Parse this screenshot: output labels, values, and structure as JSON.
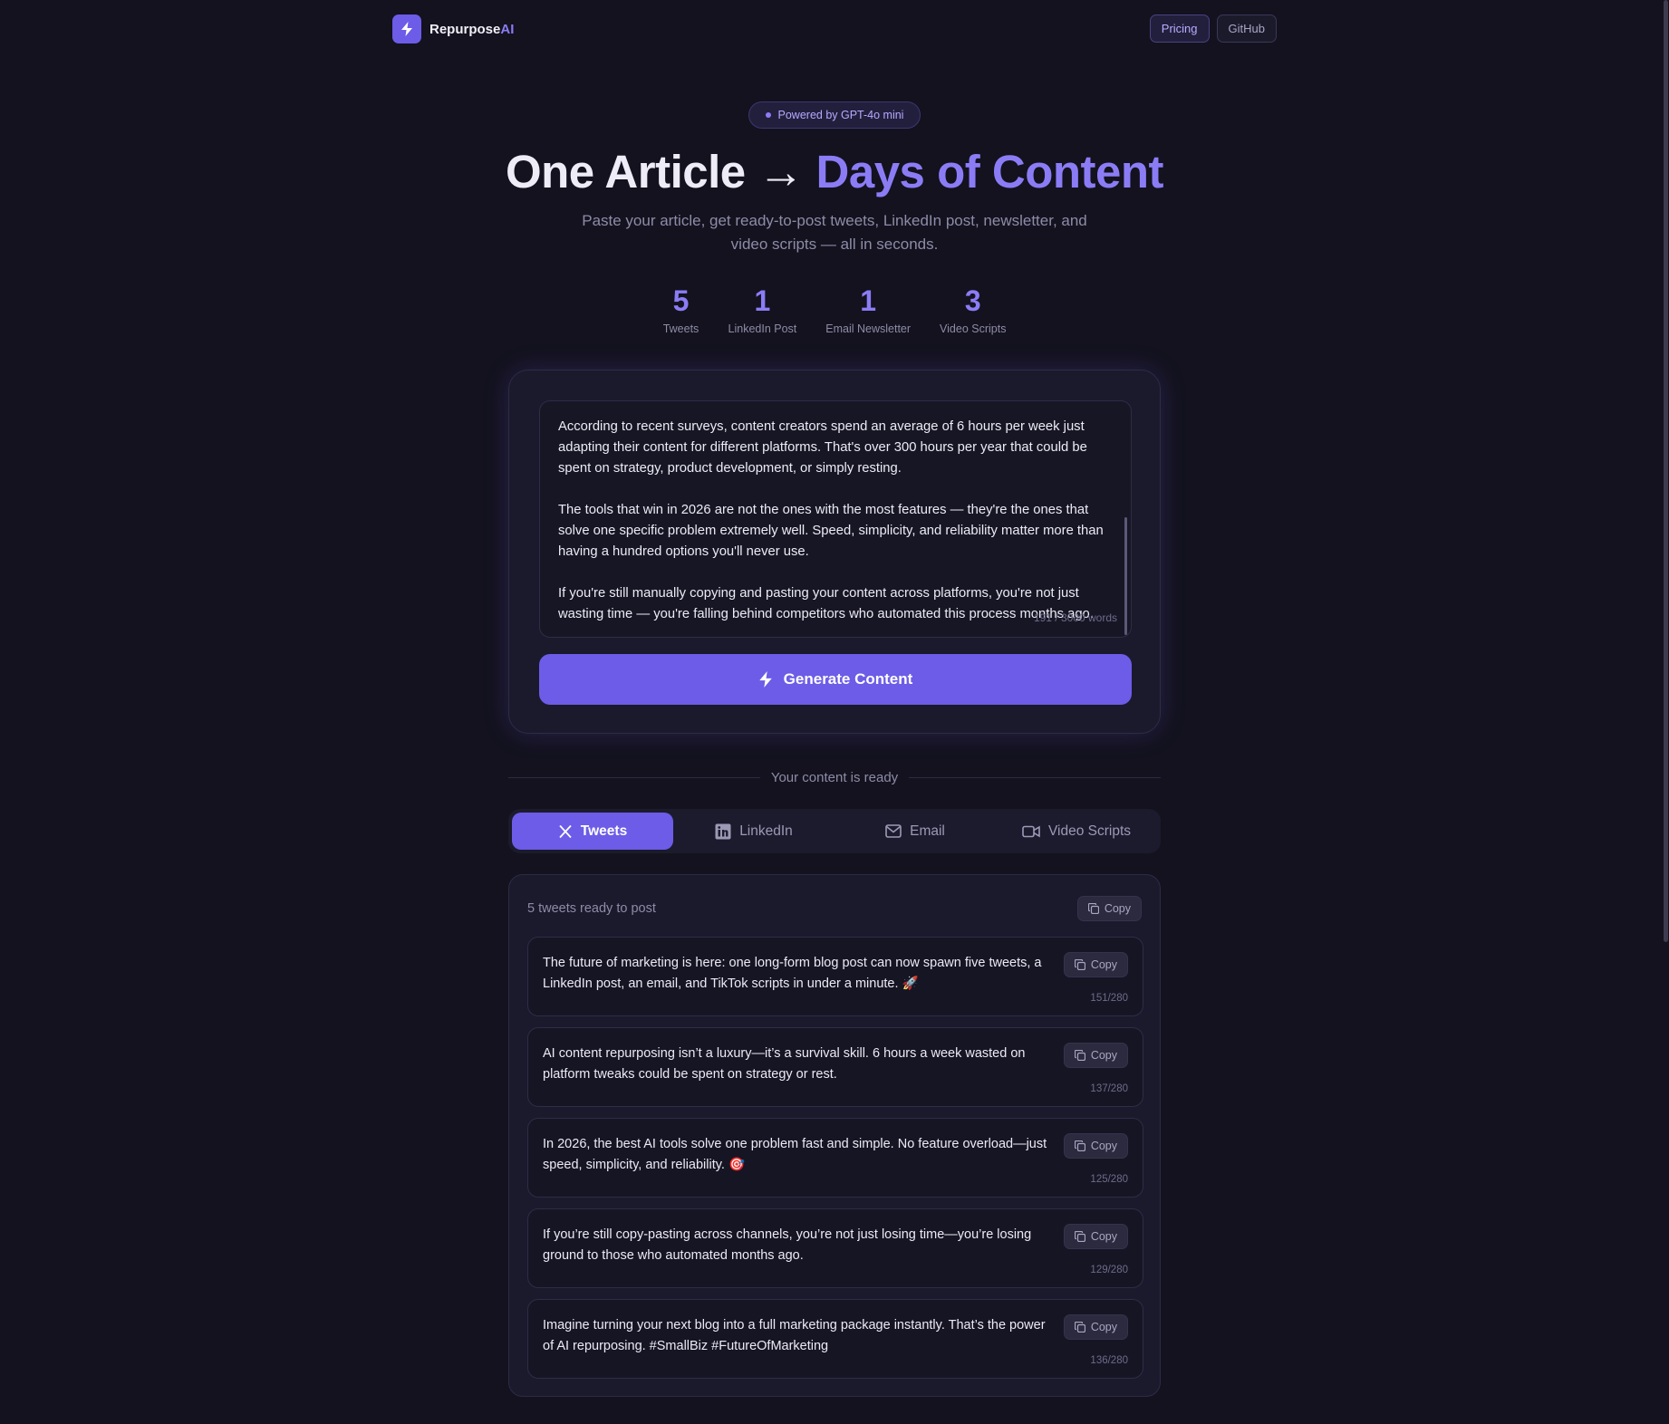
{
  "header": {
    "brand_main": "Repurpose",
    "brand_accent": "AI",
    "nav": [
      "Pricing",
      "GitHub"
    ]
  },
  "hero": {
    "badge": "Powered by GPT-4o mini",
    "title_main": "One Article →",
    "title_accent": "Days of Content",
    "subtitle": "Paste your article, get ready-to-post tweets, LinkedIn post, newsletter, and video scripts — all in seconds."
  },
  "stats": [
    {
      "value": "5",
      "label": "Tweets"
    },
    {
      "value": "1",
      "label": "LinkedIn Post"
    },
    {
      "value": "1",
      "label": "Email Newsletter"
    },
    {
      "value": "3",
      "label": "Video Scripts"
    }
  ],
  "editor": {
    "paragraphs": [
      "According to recent surveys, content creators spend an average of 6 hours per week just adapting their content for different platforms. That's over 300 hours per year that could be spent on strategy, product development, or simply resting.",
      "The tools that win in 2026 are not the ones with the most features — they're the ones that solve one specific problem extremely well. Speed, simplicity, and reliability matter more than having a hundred options you'll never use.",
      "If you're still manually copying and pasting your content across platforms, you're not just wasting time — you're falling behind competitors who automated this process months ago."
    ],
    "word_count": "191 / 3000 words",
    "generate_label": "Generate Content"
  },
  "divider_text": "Your content is ready",
  "tabs": [
    {
      "label": "Tweets",
      "icon": "x-logo-icon",
      "active": true
    },
    {
      "label": "LinkedIn",
      "icon": "linkedin-icon",
      "active": false
    },
    {
      "label": "Email",
      "icon": "mail-icon",
      "active": false
    },
    {
      "label": "Video Scripts",
      "icon": "video-icon",
      "active": false
    }
  ],
  "results": {
    "title": "5 tweets ready to post",
    "copy_label": "Copy",
    "tweets": [
      {
        "text": "The future of marketing is here: one long-form blog post can now spawn five tweets, a LinkedIn post, an email, and TikTok scripts in under a minute. 🚀",
        "count": "151/280"
      },
      {
        "text": "AI content repurposing isn’t a luxury—it’s a survival skill. 6 hours a week wasted on platform tweaks could be spent on strategy or rest.",
        "count": "137/280"
      },
      {
        "text": "In 2026, the best AI tools solve one problem fast and simple. No feature overload—just speed, simplicity, and reliability. 🎯",
        "count": "125/280"
      },
      {
        "text": "If you’re still copy-pasting across channels, you’re not just losing time—you’re losing ground to those who automated months ago.",
        "count": "129/280"
      },
      {
        "text": "Imagine turning your next blog into a full marketing package instantly. That’s the power of AI repurposing. #SmallBiz #FutureOfMarketing",
        "count": "136/280"
      }
    ]
  },
  "colors": {
    "accent": "#6c5ce7",
    "accent_text": "#8b7cf6",
    "background": "#13121e"
  }
}
